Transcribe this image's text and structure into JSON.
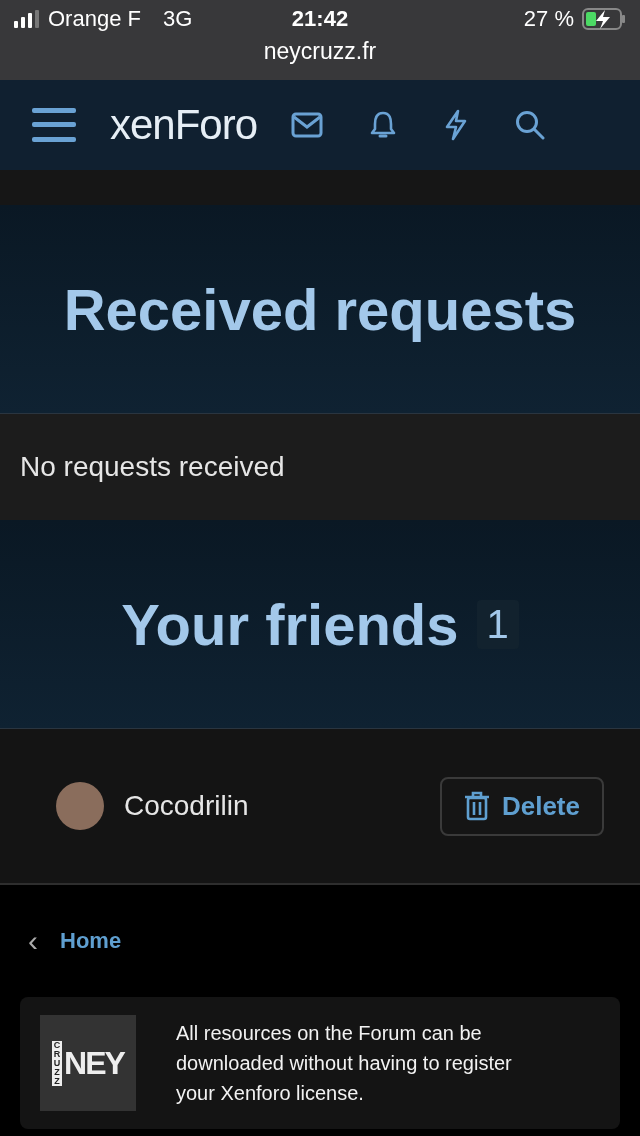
{
  "status_bar": {
    "carrier": "Orange F",
    "network": "3G",
    "time": "21:42",
    "battery": "27 %",
    "url": "neycruzz.fr"
  },
  "header": {
    "logo": "xenForo"
  },
  "sections": [
    {
      "title": "Received requests",
      "empty_text": "No requests received"
    },
    {
      "title": "Your friends",
      "count": "1",
      "friends": [
        {
          "name": "Cocodrilin",
          "action": "Delete"
        }
      ]
    }
  ],
  "breadcrumb": {
    "caret": "‹",
    "label": "Home"
  },
  "notice": {
    "logo_small": "CRUZZ",
    "logo_big": "NEY",
    "text": "All resources on the Forum can be downloaded without having to register your Xenforo license."
  }
}
